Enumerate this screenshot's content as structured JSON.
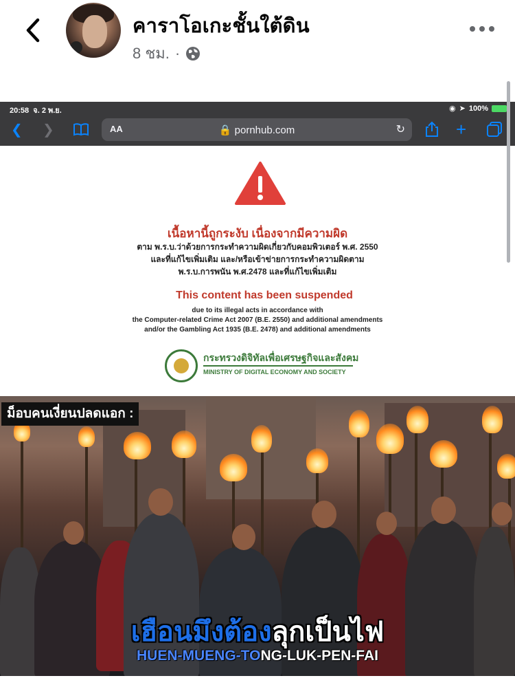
{
  "post": {
    "author": "คาราโอเกะชั้นใต้ดิน",
    "time": "8 ชม.",
    "separator": "·",
    "privacy_icon": "globe-icon",
    "back_icon": "chevron-left-icon",
    "more_icon": "more-horizontal-icon"
  },
  "screenshot": {
    "status_time": "20:58",
    "status_date": "จ. 2 พ.ย.",
    "battery": "100%",
    "url": "pornhub.com",
    "text_size_label": "AA",
    "warning_icon": "warning-triangle-icon",
    "thai_heading": "เนื้อหานี้ถูกระงับ เนื่องจากมีความผิด",
    "thai_lines": [
      "ตาม พ.ร.บ.ว่าด้วยการกระทำความผิดเกี่ยวกับคอมพิวเตอร์ พ.ศ. 2550",
      "และที่แก้ไขเพิ่มเติม และ/หรือเข้าข่ายการกระทำความผิดตาม",
      "พ.ร.บ.การพนัน พ.ศ.2478 และที่แก้ไขเพิ่มเติม"
    ],
    "english_heading": "This content has been suspended",
    "english_lines": [
      "due to its illegal acts in accordance with",
      "the Computer-related Crime Act 2007 (B.E. 2550) and additional amendments",
      "and/or the Gambling Act 1935 (B.E. 2478) and additional amendments"
    ],
    "ministry_thai": "กระทรวงดิจิทัลเพื่อเศรษฐกิจและสังคม",
    "ministry_english": "MINISTRY OF DIGITAL ECONOMY AND SOCIETY"
  },
  "meme": {
    "label": "ม็อบคนเงี่ยนปลดแอก :",
    "caption_thai_blue": "เฮือนมึงต้อง",
    "caption_thai_white": "ลุกเป็นไฟ",
    "caption_en_blue": "HUEN-MUENG-TO",
    "caption_en_white": "NG-LUK-PEN-FAI"
  },
  "colors": {
    "facebook_text": "#050505",
    "meta_grey": "#65676b",
    "warning_red": "#e0403a",
    "ministry_green": "#3c7a3a",
    "safari_blue": "#0a84ff",
    "caption_blue": "#1e6fe8"
  }
}
